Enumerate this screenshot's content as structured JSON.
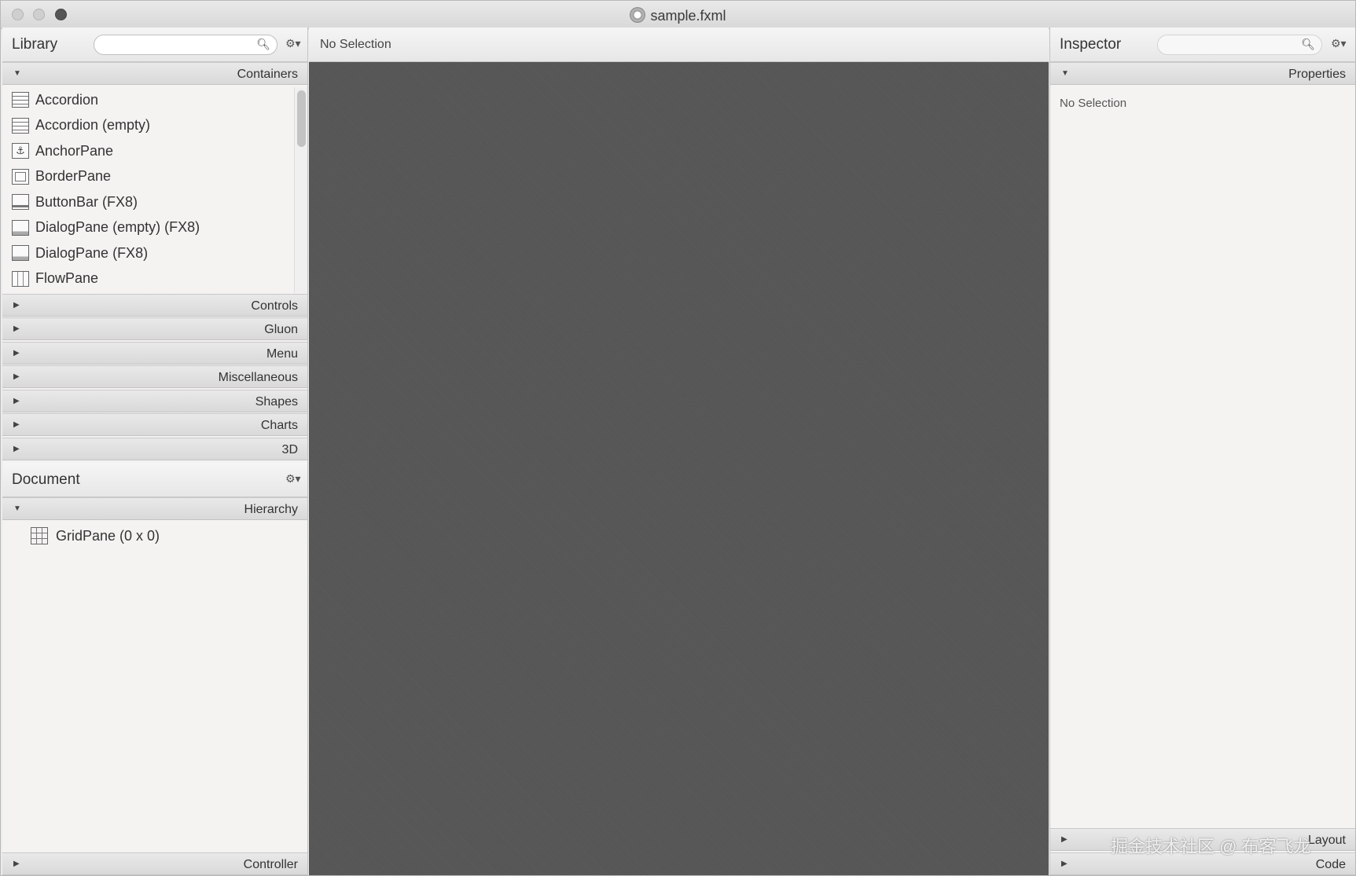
{
  "window": {
    "title": "sample.fxml"
  },
  "library": {
    "title": "Library",
    "search_value": "",
    "sections": {
      "containers": "Containers",
      "controls": "Controls",
      "gluon": "Gluon",
      "menu": "Menu",
      "miscellaneous": "Miscellaneous",
      "shapes": "Shapes",
      "charts": "Charts",
      "three_d": "3D"
    },
    "items": [
      {
        "label": "Accordion",
        "icon": "accordion-icon"
      },
      {
        "label": "Accordion  (empty)",
        "icon": "accordion-icon"
      },
      {
        "label": "AnchorPane",
        "icon": "anchor-icon"
      },
      {
        "label": "BorderPane",
        "icon": "borderpane-icon"
      },
      {
        "label": "ButtonBar  (FX8)",
        "icon": "buttonbar-icon"
      },
      {
        "label": "DialogPane (empty)  (FX8)",
        "icon": "dialog-icon"
      },
      {
        "label": "DialogPane  (FX8)",
        "icon": "dialog-icon"
      },
      {
        "label": "FlowPane",
        "icon": "flowpane-icon"
      }
    ]
  },
  "document": {
    "title": "Document",
    "hierarchy": "Hierarchy",
    "tree": [
      {
        "label": "GridPane (0 x 0)",
        "icon": "gridpane-icon"
      }
    ],
    "controller": "Controller"
  },
  "canvas": {
    "selection": "No Selection"
  },
  "inspector": {
    "title": "Inspector",
    "search_value": "",
    "properties": "Properties",
    "no_selection": "No Selection",
    "layout": "Layout",
    "code": "Code"
  },
  "watermark": "掘金技术社区 @ 布客飞龙"
}
